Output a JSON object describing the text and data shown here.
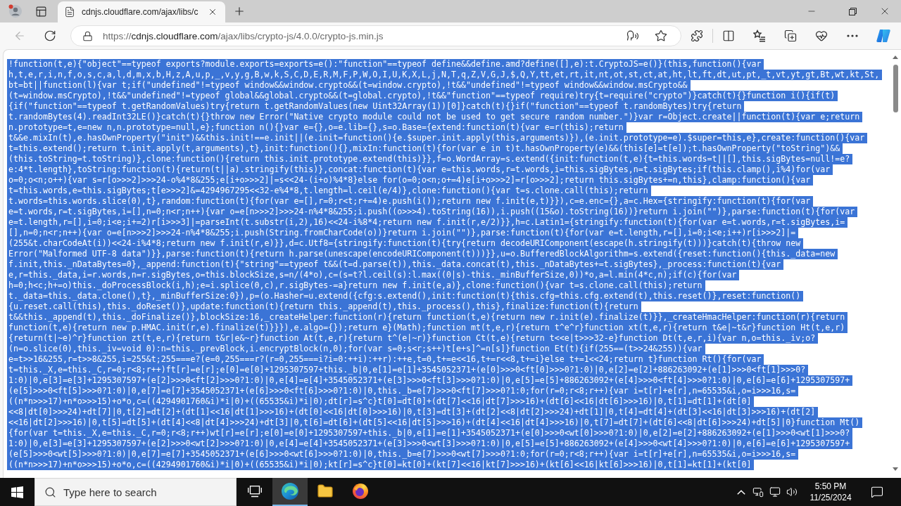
{
  "browser": {
    "tabs": [
      {
        "title": "cdnjs.cloudflare.com/ajax/libs/c",
        "selected": true
      }
    ],
    "back_button": {
      "disabled": true
    },
    "address": {
      "scheme": "https://",
      "host": "cdnjs.cloudflare.com",
      "path": "/ajax/libs/crypto-js/4.0.0/crypto-js.min.js"
    }
  },
  "document": {
    "selected": true,
    "lines": [
      "!function(t,e){\"object\"==typeof exports?module.exports=exports=e():\"function\"==typeof define&&define.amd?define([],e):t.CryptoJS=e()}(this,function(){var",
      "h,t,e,r,i,n,f,o,s,c,a,l,d,m,x,b,H,z,A,u,p,_,v,y,g,B,w,k,S,C,D,E,R,M,F,P,W,O,I,U,K,X,L,j,N,T,q,Z,V,G,J,$,Q,Y,tt,et,rt,it,nt,ot,st,ct,at,ht,lt,ft,dt,ut,pt,_t,vt,yt,gt,Bt,wt,kt,St,",
      "bt=bt||function(l){var t;if(\"undefined\"!=typeof window&&window.crypto&&(t=window.crypto),!t&&\"undefined\"!=typeof window&&window.msCrypto&&",
      "(t=window.msCrypto),!t&&\"undefined\"!=typeof global&&global.crypto&&(t=global.crypto),!t&&\"function\"==typeof require)try{t=require(\"crypto\")}catch(t){}function i(){if(t)",
      "{if(\"function\"==typeof t.getRandomValues)try{return t.getRandomValues(new Uint32Array(1))[0]}catch(t){}if(\"function\"==typeof t.randomBytes)try{return",
      "t.randomBytes(4).readInt32LE()}catch(t){}throw new Error(\"Native crypto module could not be used to get secure random number.\")}var r=Object.create||function(t){var e;return",
      "n.prototype=t,e=new n,n.prototype=null,e};function n(){}var e={},o=e.lib={},s=o.Base={extend:function(t){var e=r(this);return",
      "t&&e.mixIn(t),e.hasOwnProperty(\"init\")&&this.init!==e.init||(e.init=function(){e.$super.init.apply(this,arguments)}),(e.init.prototype=e).$super=this,e},create:function(){var",
      "t=this.extend();return t.init.apply(t,arguments),t},init:function(){},mixIn:function(t){for(var e in t)t.hasOwnProperty(e)&&(this[e]=t[e]);t.hasOwnProperty(\"toString\")&&",
      "(this.toString=t.toString)},clone:function(){return this.init.prototype.extend(this)}},f=o.WordArray=s.extend({init:function(t,e){t=this.words=t||[],this.sigBytes=null!=e?",
      "e:4*t.length},toString:function(t){return(t||a).stringify(this)},concat:function(t){var e=this.words,r=t.words,i=this.sigBytes,n=t.sigBytes;if(this.clamp(),i%4)for(var",
      "o=0;o<n;o++){var s=r[o>>>2]>>>24-o%4*8&255;e[i+o>>>2]|=s<<24-(i+o)%4*8}else for(o=0;o<n;o+=4)e[i+o>>>2]=r[o>>>2];return this.sigBytes+=n,this},clamp:function(){var",
      "t=this.words,e=this.sigBytes;t[e>>>2]&=4294967295<<32-e%4*8,t.length=l.ceil(e/4)},clone:function(){var t=s.clone.call(this);return",
      "t.words=this.words.slice(0),t},random:function(t){for(var e=[],r=0;r<t;r+=4)e.push(i());return new f.init(e,t)}}),c=e.enc={},a=c.Hex={stringify:function(t){for(var",
      "e=t.words,r=t.sigBytes,i=[],n=0;n<r;n++){var o=e[n>>>2]>>>24-n%4*8&255;i.push((o>>>4).toString(16)),i.push((15&o).toString(16))}return i.join(\"\")},parse:function(t){for(var",
      "e=t.length,r=[],i=0;i<e;i+=2)r[i>>>3]|=parseInt(t.substr(i,2),16)<<24-i%8*4;return new f.init(r,e/2)}},h=c.Latin1={stringify:function(t){for(var e=t.words,r=t.sigBytes,i=",
      "[],n=0;n<r;n++){var o=e[n>>>2]>>>24-n%4*8&255;i.push(String.fromCharCode(o))}return i.join(\"\")},parse:function(t){for(var e=t.length,r=[],i=0;i<e;i++)r[i>>>2]|=",
      "(255&t.charCodeAt(i))<<24-i%4*8;return new f.init(r,e)}},d=c.Utf8={stringify:function(t){try{return decodeURIComponent(escape(h.stringify(t)))}catch(t){throw new",
      "Error(\"Malformed UTF-8 data\")}},parse:function(t){return h.parse(unescape(encodeURIComponent(t)))}},u=o.BufferedBlockAlgorithm=s.extend({reset:function(){this._data=new",
      "f.init,this._nDataBytes=0},_append:function(t){\"string\"==typeof t&&(t=d.parse(t)),this._data.concat(t),this._nDataBytes+=t.sigBytes},_process:function(t){var",
      "e,r=this._data,i=r.words,n=r.sigBytes,o=this.blockSize,s=n/(4*o),c=(s=t?l.ceil(s):l.max((0|s)-this._minBufferSize,0))*o,a=l.min(4*c,n);if(c){for(var",
      "h=0;h<c;h+=o)this._doProcessBlock(i,h);e=i.splice(0,c),r.sigBytes-=a}return new f.init(e,a)},clone:function(){var t=s.clone.call(this);return",
      "t._data=this._data.clone(),t},_minBufferSize:0}),p=(o.Hasher=u.extend({cfg:s.extend(),init:function(t){this.cfg=this.cfg.extend(t),this.reset()},reset:function()",
      "{u.reset.call(this),this._doReset()},update:function(t){return this._append(t),this._process(),this},finalize:function(t){return",
      "t&&this._append(t),this._doFinalize()},blockSize:16,_createHelper:function(r){return function(t,e){return new r.init(e).finalize(t)}},_createHmacHelper:function(r){return",
      "function(t,e){return new p.HMAC.init(r,e).finalize(t)}}}),e.algo={});return e}(Math);function mt(t,e,r){return t^e^r}function xt(t,e,r){return t&e|~t&r}function Ht(t,e,r)",
      "{return(t|~e)^r}function zt(t,e,r){return t&r|e&~r}function At(t,e,r){return t^(e|~r)}function Ct(t,e){return t<<e|t>>>32-e}function Dt(t,e,r,i){var n,o=this._iv;o?",
      "(n=o.slice(0),this._iv=void 0):n=this._prevBlock,i.encryptBlock(n,0);for(var s=0;s<r;s++)t[e+s]^=n[s]}function Et(t){if(255==(t>>24&255)){var",
      "e=t>>16&255,r=t>>8&255,i=255&t;255===e?(e=0,255===r?(r=0,255===i?i=0:++i):++r):++e,t=0,t+=e<<16,t+=r<<8,t+=i}else t+=1<<24;return t}function Rt(){for(var",
      "t=this._X,e=this._C,r=0;r<8;r++)ft[r]=e[r];e[0]=e[0]+1295307597+this._b|0,e[1]=e[1]+3545052371+(e[0]>>>0<ft[0]>>>0?1:0)|0,e[2]=e[2]+886263092+(e[1]>>>0<ft[1]>>>0?",
      "1:0)|0,e[3]=e[3]+1295307597+(e[2]>>>0<ft[2]>>>0?1:0)|0,e[4]=e[4]+3545052371+(e[3]>>>0<ft[3]>>>0?1:0)|0,e[5]=e[5]+886263092+(e[4]>>>0<ft[4]>>>0?1:0)|0,e[6]=e[6]+1295307597+",
      "(e[5]>>>0<ft[5]>>>0?1:0)|0,e[7]=e[7]+3545052371+(e[6]>>>0<ft[6]>>>0?1:0)|0,this._b=e[7]>>>0<ft[7]>>>0?1:0;for(r=0;r<8;r++){var i=t[r]+e[r],n=65535&i,o=i>>>16,s=",
      "((n*n>>>17)+n*o>>>15)+o*o,c=((4294901760&i)*i|0)+((65535&i)*i|0);dt[r]=s^c}t[0]=dt[0]+(dt[7]<<16|dt[7]>>>16)+(dt[6]<<16|dt[6]>>>16)|0,t[1]=dt[1]+(dt[0]",
      "<<8|dt[0]>>>24)+dt[7]|0,t[2]=dt[2]+(dt[1]<<16|dt[1]>>>16)+(dt[0]<<16|dt[0]>>>16)|0,t[3]=dt[3]+(dt[2]<<8|dt[2]>>>24)+dt[1]|0,t[4]=dt[4]+(dt[3]<<16|dt[3]>>>16)+(dt[2]",
      "<<16|dt[2]>>>16)|0,t[5]=dt[5]+(dt[4]<<8|dt[4]>>>24)+dt[3]|0,t[6]=dt[6]+(dt[5]<<16|dt[5]>>>16)+(dt[4]<<16|dt[4]>>>16)|0,t[7]=dt[7]+(dt[6]<<8|dt[6]>>>24)+dt[5]|0}function Mt()",
      "{for(var t=this._X,e=this._C,r=0;r<8;r++)wt[r]=e[r];e[0]=e[0]+1295307597+this._b|0,e[1]=e[1]+3545052371+(e[0]>>>0<wt[0]>>>0?1:0)|0,e[2]=e[2]+886263092+(e[1]>>>0<wt[1]>>>0?",
      "1:0)|0,e[3]=e[3]+1295307597+(e[2]>>>0<wt[2]>>>0?1:0)|0,e[4]=e[4]+3545052371+(e[3]>>>0<wt[3]>>>0?1:0)|0,e[5]=e[5]+886263092+(e[4]>>>0<wt[4]>>>0?1:0)|0,e[6]=e[6]+1295307597+",
      "(e[5]>>>0<wt[5]>>>0?1:0)|0,e[7]=e[7]+3545052371+(e[6]>>>0<wt[6]>>>0?1:0)|0,this._b=e[7]>>>0<wt[7]>>>0?1:0;for(r=0;r<8;r++){var i=t[r]+e[r],n=65535&i,o=i>>>16,s=",
      "((n*n>>>17)+n*o>>>15)+o*o,c=((4294901760&i)*i|0)+((65535&i)*i|0);kt[r]=s^c}t[0]=kt[0]+(kt[7]<<16|kt[7]>>>16)+(kt[6]<<16|kt[6]>>>16)|0,t[1]=kt[1]+(kt[0]"
    ]
  },
  "taskbar": {
    "search": {
      "placeholder": "Type here to search"
    },
    "apps": [
      {
        "kind": "task_view",
        "active": false
      },
      {
        "kind": "edge",
        "active": true
      },
      {
        "kind": "explorer",
        "active": false
      },
      {
        "kind": "firefox",
        "active": false
      }
    ],
    "time": "5:50 PM",
    "date": "11/25/2024"
  }
}
